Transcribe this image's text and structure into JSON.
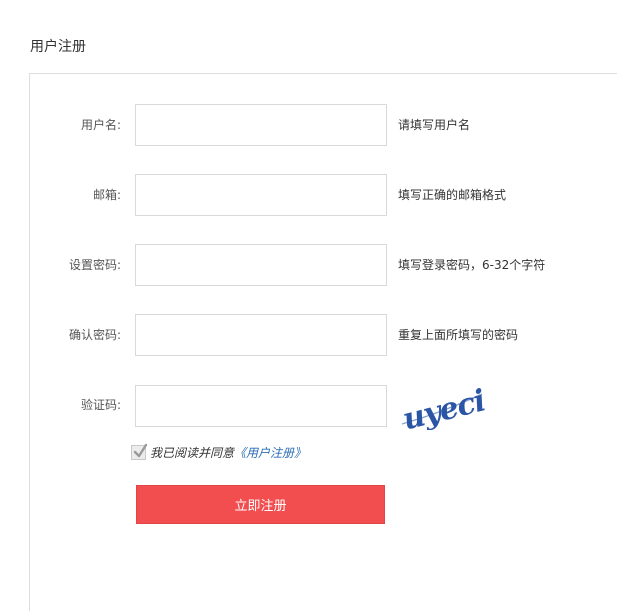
{
  "page": {
    "title": "用户注册"
  },
  "form": {
    "fields": [
      {
        "label": "用户名:",
        "value": "",
        "placeholder": "",
        "hint": "请填写用户名"
      },
      {
        "label": "邮箱:",
        "value": "",
        "placeholder": "",
        "hint": "填写正确的邮箱格式"
      },
      {
        "label": "设置密码:",
        "value": "",
        "placeholder": "",
        "hint": "填写登录密码，6-32个字符"
      },
      {
        "label": "确认密码:",
        "value": "",
        "placeholder": "",
        "hint": "重复上面所填写的密码"
      },
      {
        "label": "验证码:",
        "value": "",
        "placeholder": ""
      }
    ],
    "captcha_text": "uyeci",
    "agreement": {
      "checked": true,
      "text": "我已阅读并同意",
      "link_text": "《用户注册》"
    },
    "submit_label": "立即注册"
  },
  "colors": {
    "submit_button": "#f24d4f",
    "link": "#2a6db3",
    "captcha": "#2b55a5"
  }
}
